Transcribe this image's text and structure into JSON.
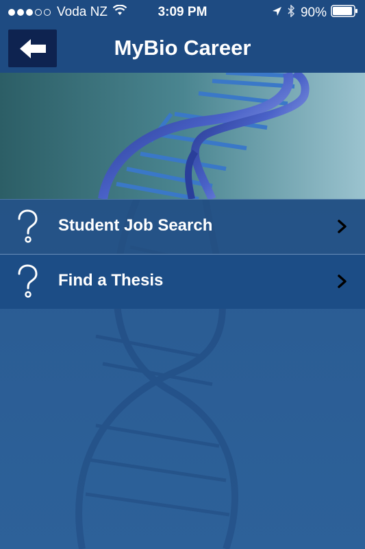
{
  "status_bar": {
    "carrier": "Voda NZ",
    "time": "3:09 PM",
    "battery": "90%",
    "signal_icon": "signal-dots-icon",
    "wifi_icon": "wifi-icon",
    "location_icon": "location-arrow-icon",
    "bluetooth_icon": "bluetooth-icon",
    "battery_icon": "battery-icon"
  },
  "nav": {
    "title": "MyBio Career",
    "back_icon": "back-arrow-icon"
  },
  "banner": {
    "image": "dna-helix-image"
  },
  "menu": {
    "items": [
      {
        "label": "Student Job Search",
        "icon": "question-mark-icon",
        "chevron": "chevron-right-icon"
      },
      {
        "label": "Find a Thesis",
        "icon": "question-mark-icon",
        "chevron": "chevron-right-icon"
      }
    ]
  },
  "colors": {
    "nav_bar": "#1e4b82",
    "back_button": "#0e2350",
    "background": "#2a5b92",
    "row_selected": "#1c4d86"
  }
}
